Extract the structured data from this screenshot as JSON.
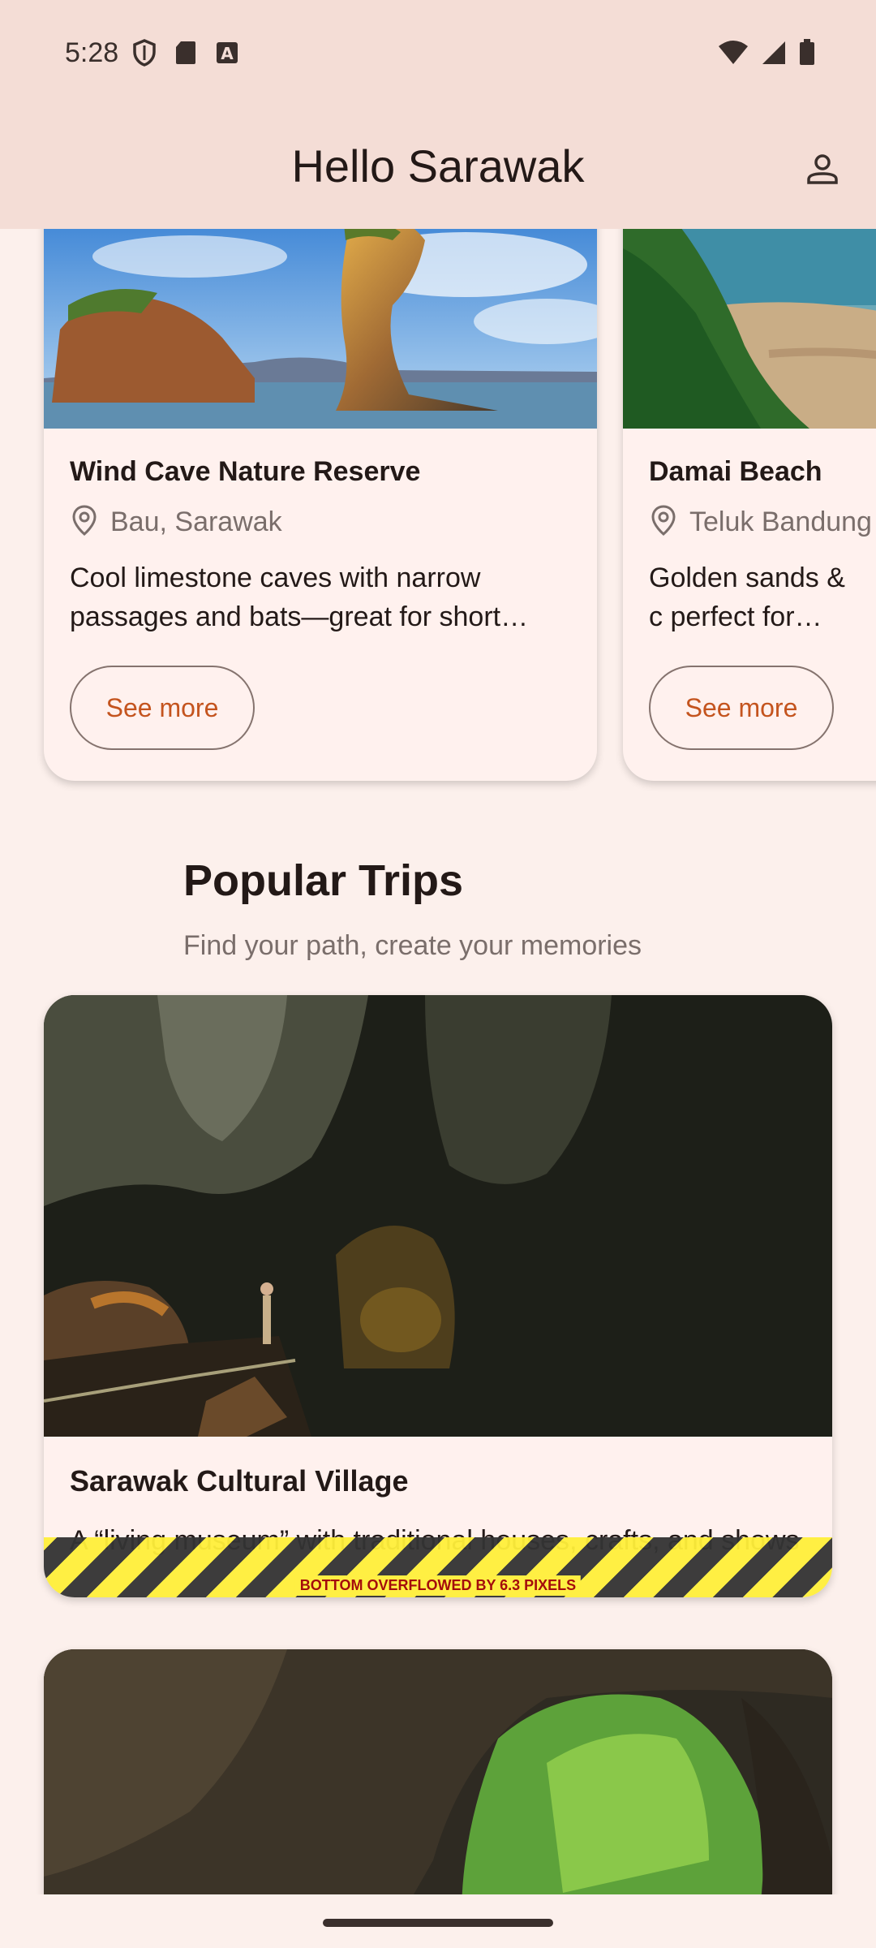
{
  "status_bar": {
    "time": "5:28"
  },
  "app_bar": {
    "title": "Hello Sarawak"
  },
  "destinations": [
    {
      "name": "Wind Cave Nature Reserve",
      "location": "Bau, Sarawak",
      "description": "Cool limestone caves with narrow passages and bats—great for short…",
      "button": "See more"
    },
    {
      "name": "Damai Beach",
      "location": "Teluk Bandung",
      "description": "Golden sands & c perfect for swim",
      "button": "See more"
    }
  ],
  "section": {
    "title": "Popular Trips",
    "subtitle": "Find your path, create your memories"
  },
  "trips": [
    {
      "name": "Sarawak Cultural Village",
      "description": "A “living museum” with traditional houses, crafts, and shows",
      "overflow_warning": "BOTTOM OVERFLOWED BY 6.3 PIXELS"
    },
    {
      "name": "",
      "description": ""
    }
  ],
  "colors": {
    "app_bar_bg": "#f4ddd6",
    "page_bg": "#fcf0ec",
    "card_bg": "#fff1ee",
    "accent": "#c4541e"
  }
}
